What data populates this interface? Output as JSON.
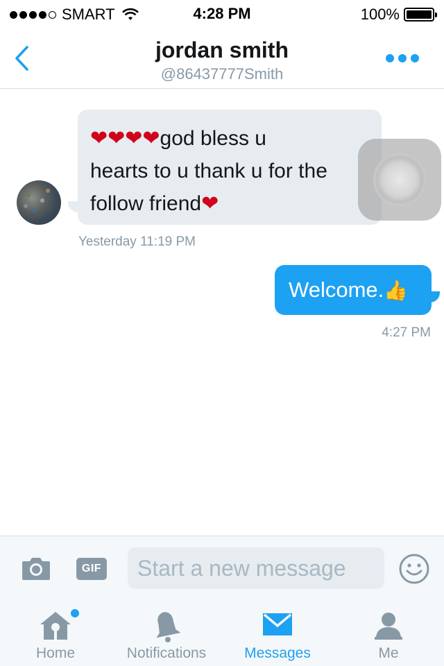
{
  "status_bar": {
    "carrier": "SMART",
    "time": "4:28 PM",
    "battery": "100%",
    "signal_bars": 4,
    "signal_max": 5
  },
  "header": {
    "name": "jordan smith",
    "handle": "@86437777Smith",
    "back_icon": "chevron-left-icon",
    "more_icon": "more-dots-icon"
  },
  "conversation": {
    "incoming": {
      "line1_text": "god bless u",
      "line2": "hearts to u thank u for the",
      "line3_text": "follow friend",
      "hearts_prefix": "❤❤❤❤",
      "heart_suffix": "❤",
      "timestamp": "Yesterday 11:19 PM"
    },
    "outgoing": {
      "text": "Welcome.",
      "emoji": "👍",
      "timestamp": "4:27 PM"
    }
  },
  "composer": {
    "placeholder": "Start a new message",
    "gif_label": "GIF",
    "camera_icon": "camera-icon",
    "emoji_icon": "smiley-icon"
  },
  "tabs": [
    {
      "label": "Home",
      "icon": "home-icon",
      "active": false,
      "badge": true
    },
    {
      "label": "Notifications",
      "icon": "bell-icon",
      "active": false,
      "badge": false
    },
    {
      "label": "Messages",
      "icon": "envelope-icon",
      "active": true,
      "badge": false
    },
    {
      "label": "Me",
      "icon": "person-icon",
      "active": false,
      "badge": false
    }
  ],
  "colors": {
    "accent": "#1da1f2",
    "muted": "#8899a6",
    "bubble_in": "#e6ecf0",
    "heart": "#d0021b"
  }
}
